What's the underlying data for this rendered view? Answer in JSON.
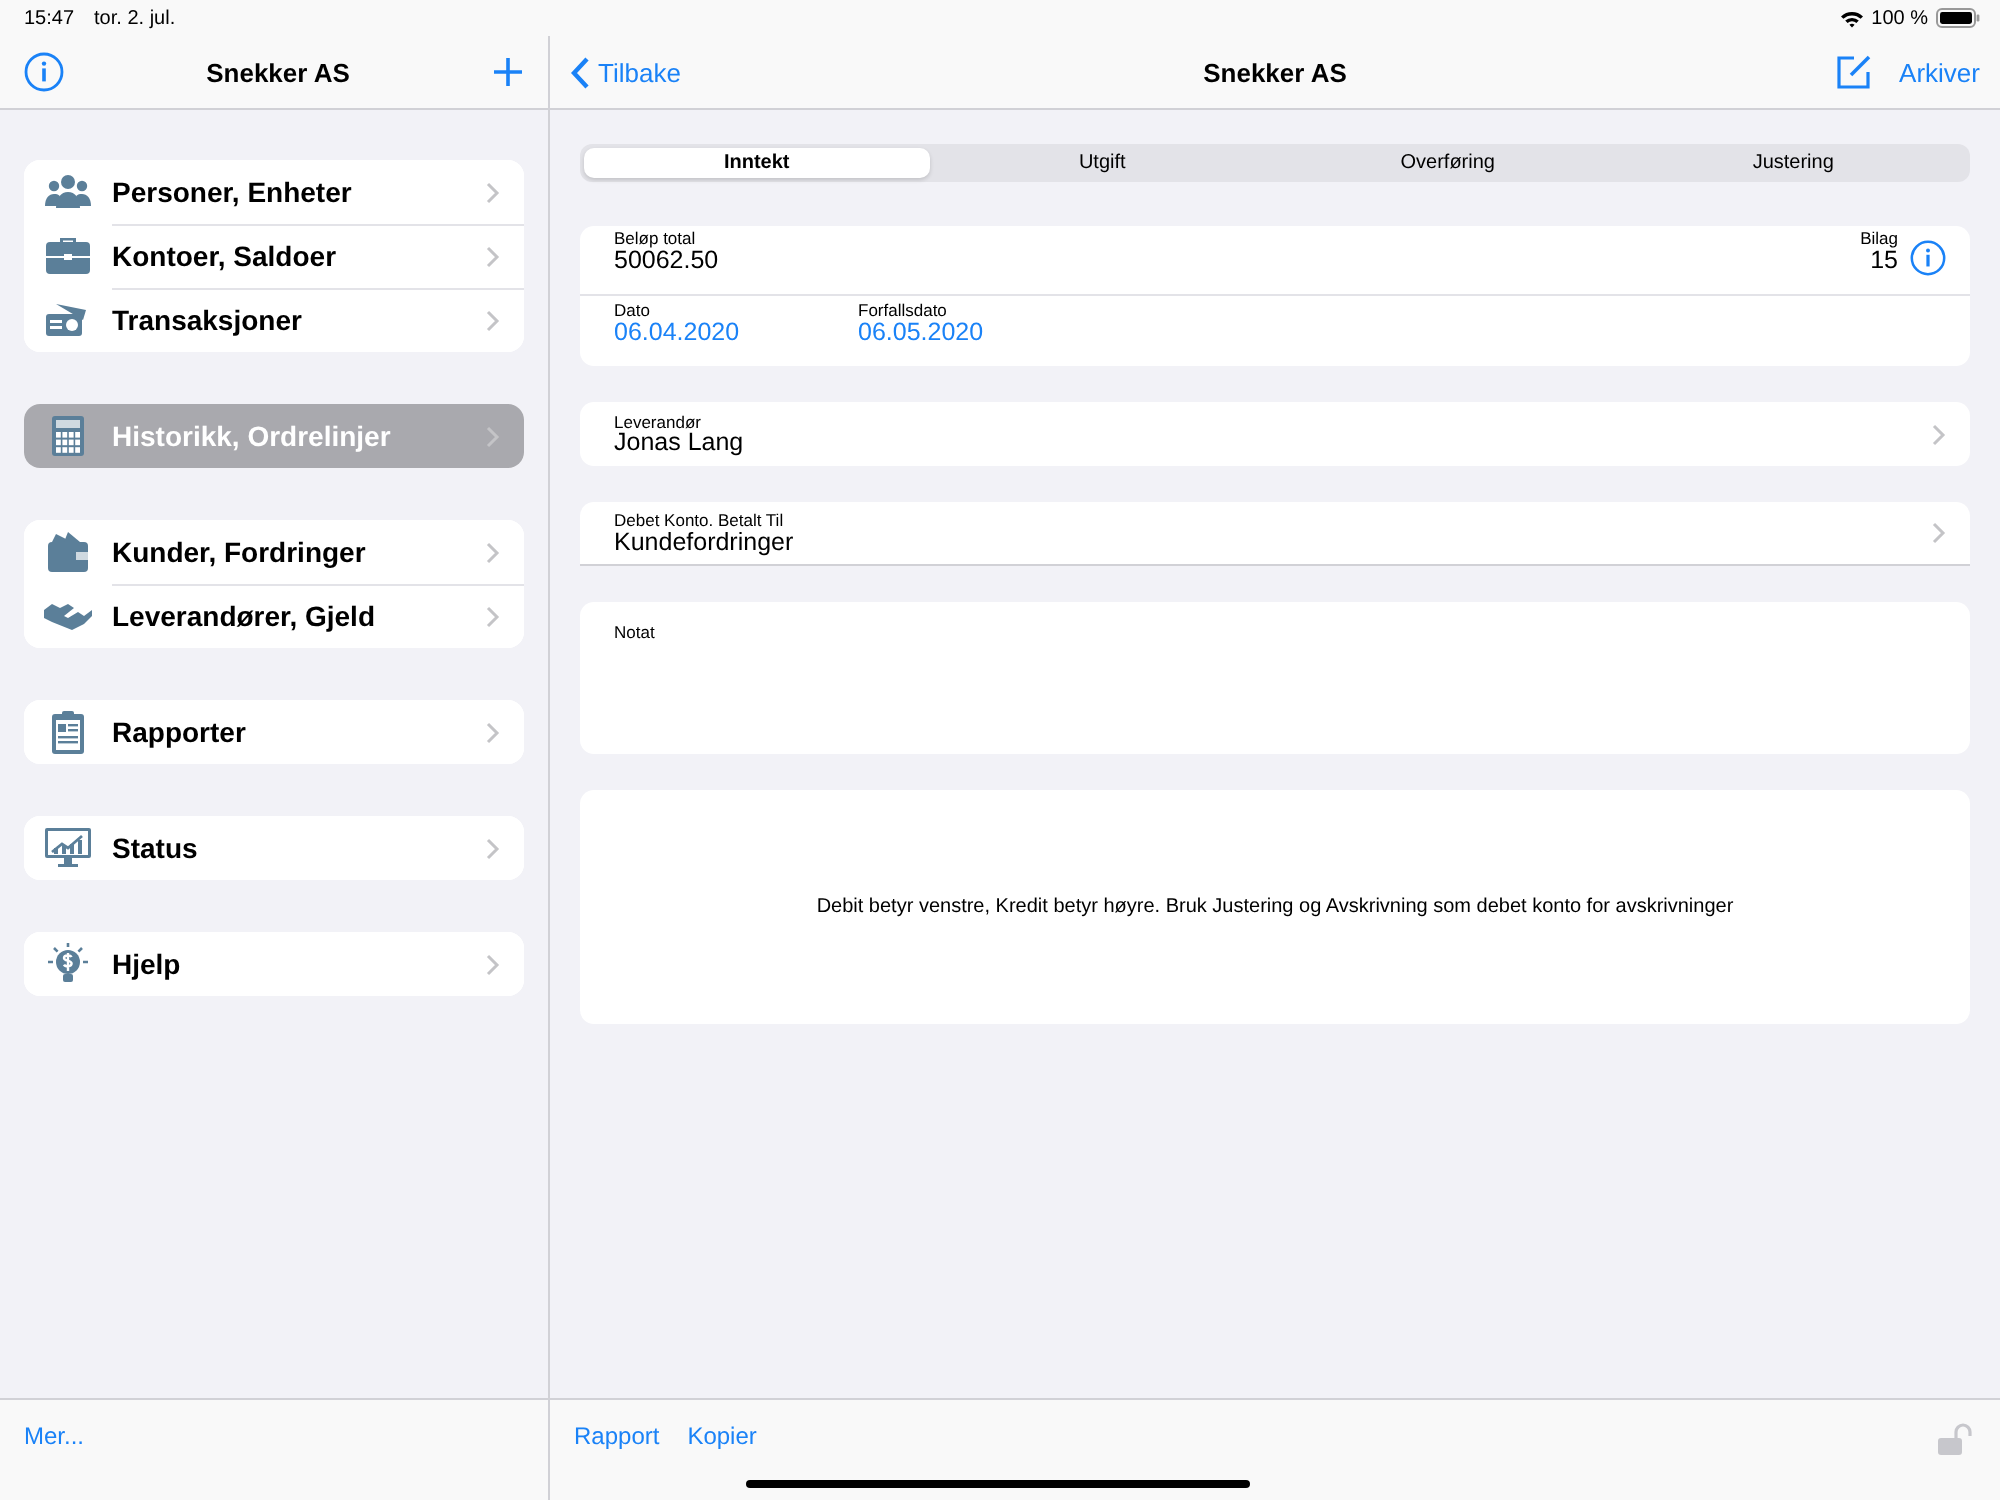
{
  "status_bar": {
    "time": "15:47",
    "date": "tor. 2. jul.",
    "battery": "100 %"
  },
  "sidebar": {
    "title": "Snekker AS",
    "groups": [
      {
        "items": [
          {
            "label": "Personer, Enheter",
            "selected": false
          },
          {
            "label": "Kontoer, Saldoer",
            "selected": false
          },
          {
            "label": "Transaksjoner",
            "selected": false
          }
        ]
      },
      {
        "items": [
          {
            "label": "Historikk, Ordrelinjer",
            "selected": true
          }
        ]
      },
      {
        "items": [
          {
            "label": "Kunder, Fordringer",
            "selected": false
          },
          {
            "label": "Leverandører, Gjeld",
            "selected": false
          }
        ]
      },
      {
        "items": [
          {
            "label": "Rapporter",
            "selected": false
          }
        ]
      },
      {
        "items": [
          {
            "label": "Status",
            "selected": false
          }
        ]
      },
      {
        "items": [
          {
            "label": "Hjelp",
            "selected": false
          }
        ]
      }
    ],
    "footer_link": "Mer..."
  },
  "detail": {
    "back": "Tilbake",
    "title": "Snekker AS",
    "archive": "Arkiver",
    "tabs": [
      {
        "label": "Inntekt",
        "selected": true
      },
      {
        "label": "Utgift",
        "selected": false
      },
      {
        "label": "Overføring",
        "selected": false
      },
      {
        "label": "Justering",
        "selected": false
      }
    ],
    "amount": {
      "label": "Beløp total",
      "value": "50062.50"
    },
    "voucher": {
      "label": "Bilag",
      "value": "15"
    },
    "date": {
      "label": "Dato",
      "value": "06.04.2020"
    },
    "due_date": {
      "label": "Forfallsdato",
      "value": "06.05.2020"
    },
    "supplier": {
      "label": "Leverandør",
      "value": "Jonas Lang"
    },
    "debit_account": {
      "label": "Debet Konto. Betalt Til",
      "value": "Kundefordringer"
    },
    "note": {
      "label": "Notat"
    },
    "hint": "Debit betyr venstre, Kredit betyr høyre. Bruk Justering og Avskrivning som debet konto for avskrivninger",
    "toolbar": [
      "Rapport",
      "Kopier"
    ],
    "locked": false
  }
}
